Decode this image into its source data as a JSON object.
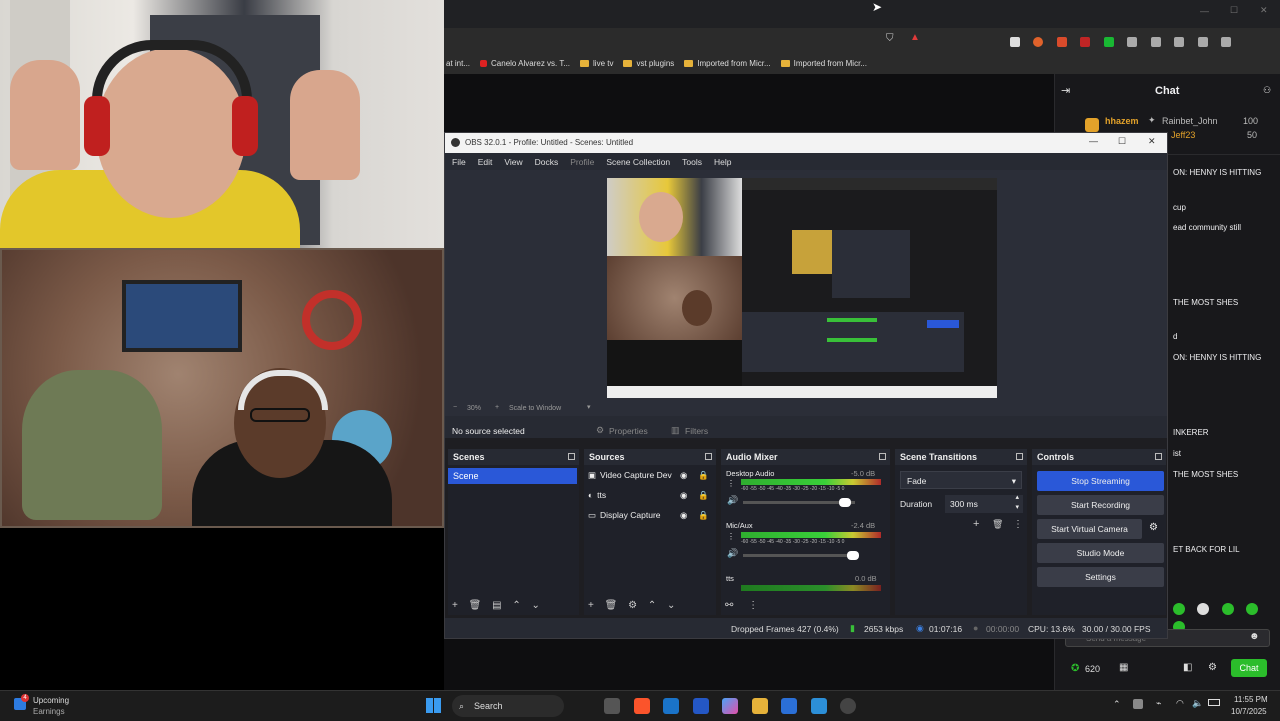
{
  "browser": {
    "bookmarks": [
      {
        "label": "at int..."
      },
      {
        "label": "Canelo Alvarez vs. T..."
      },
      {
        "label": "live tv"
      },
      {
        "label": "vst plugins"
      },
      {
        "label": "Imported from Micr..."
      },
      {
        "label": "Imported from Micr..."
      }
    ]
  },
  "chat": {
    "header": "Chat",
    "top_user": "hhazem",
    "gifter1": "Rainbet_John",
    "gifter1_count": "100",
    "gifter2": "Jeff23",
    "gifter2_count": "50",
    "lines": [
      "ON: HENNY IS HITTING",
      "cup",
      "ead community still",
      "THE MOST SHES",
      "d",
      "ON: HENNY IS HITTING",
      "INKERER",
      "ist",
      "THE MOST SHES",
      "ET BACK FOR LIL"
    ],
    "input_placeholder": "Send a message",
    "points": "620",
    "chat_button": "Chat"
  },
  "obs": {
    "title": "OBS 32.0.1 - Profile: Untitled - Scenes: Untitled",
    "menu": [
      "File",
      "Edit",
      "View",
      "Docks",
      "Profile",
      "Scene Collection",
      "Tools",
      "Help"
    ],
    "zoom": "30%",
    "scale_mode": "Scale to Window",
    "no_source": "No source selected",
    "properties_label": "Properties",
    "filters_label": "Filters",
    "scenes": {
      "title": "Scenes",
      "items": [
        "Scene"
      ]
    },
    "sources": {
      "title": "Sources",
      "items": [
        "Video Capture Dev",
        "tts",
        "Display Capture"
      ]
    },
    "audio": {
      "title": "Audio Mixer",
      "channels": [
        {
          "name": "Desktop Audio",
          "db": "-5.0 dB",
          "level": 0.75
        },
        {
          "name": "Mic/Aux",
          "db": "-2.4 dB",
          "level": 0.72
        },
        {
          "name": "tts",
          "db": "0.0 dB",
          "level": 0.7
        }
      ],
      "scale": "-60 -55 -50 -45 -40 -35 -30 -25 -20 -15 -10 -5 0"
    },
    "transitions": {
      "title": "Scene Transitions",
      "selected": "Fade",
      "duration_label": "Duration",
      "duration_value": "300 ms"
    },
    "controls": {
      "title": "Controls",
      "buttons": [
        "Stop Streaming",
        "Start Recording",
        "Start Virtual Camera",
        "Studio Mode",
        "Settings"
      ]
    },
    "status": {
      "dropped": "Dropped Frames 427 (0.4%)",
      "bitrate": "2653 kbps",
      "stream_time": "01:07:16",
      "rec_time": "00:00:00",
      "cpu": "CPU: 13.6%",
      "fps": "30.00 / 30.00 FPS"
    }
  },
  "taskbar": {
    "widget_title": "Upcoming",
    "widget_sub": "Earnings",
    "badge": "4",
    "search": "Search",
    "time": "11:55 PM",
    "date": "10/7/2025"
  },
  "colors": {
    "accent": "#2a58d8",
    "twitch": "#9147ff",
    "green": "#00c853"
  }
}
